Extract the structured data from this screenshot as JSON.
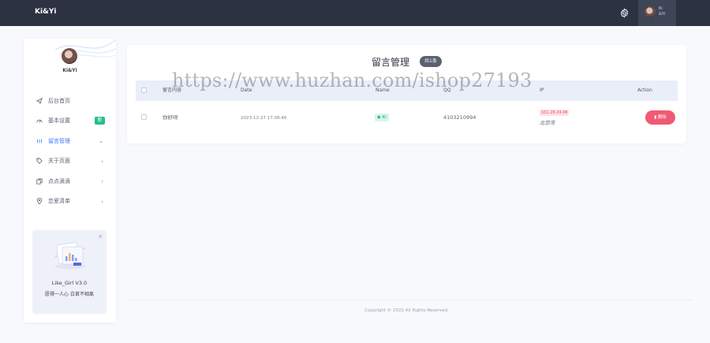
{
  "app": {
    "brand": "Ki&Yi"
  },
  "topbar": {
    "user_name_line1": "Ki",
    "user_name_line2": "&Yi"
  },
  "sidebar": {
    "profile_name": "Ki&Yi",
    "items": [
      {
        "label": "后台首页",
        "icon": "send-icon"
      },
      {
        "label": "基本设置",
        "icon": "speedometer-icon",
        "badge": "新"
      },
      {
        "label": "留言管理",
        "icon": "list-icon",
        "active": true
      },
      {
        "label": "关于页面",
        "icon": "tag-icon"
      },
      {
        "label": "点点滴滴",
        "icon": "copy-icon"
      },
      {
        "label": "恋爱清单",
        "icon": "location-pin-icon"
      }
    ],
    "promo": {
      "title": "Like_Girl V3.0",
      "subtitle": "愿得一人心 白首不相离"
    }
  },
  "main": {
    "title": "留言管理",
    "count_badge": "共1条",
    "columns": [
      "留言内容",
      "Date",
      "Name",
      "QQ",
      "IP",
      "Action"
    ],
    "rows": [
      {
        "content": "你好呀",
        "date": "2023-12-27 17:08:46",
        "name": "Ki",
        "qq": "4103210994",
        "ip": "101.28.24.48",
        "location": "北京市",
        "action": "删除"
      }
    ]
  },
  "footer": {
    "copyright": "Copyright © 2022 All Rights Reserved."
  },
  "watermark": "https://www.huzhan.com/ishop27193",
  "colors": {
    "topbar": "#2c3241",
    "accent": "#3a7bfd",
    "delete": "#f05a74",
    "name_tag": "#1ba56c"
  }
}
